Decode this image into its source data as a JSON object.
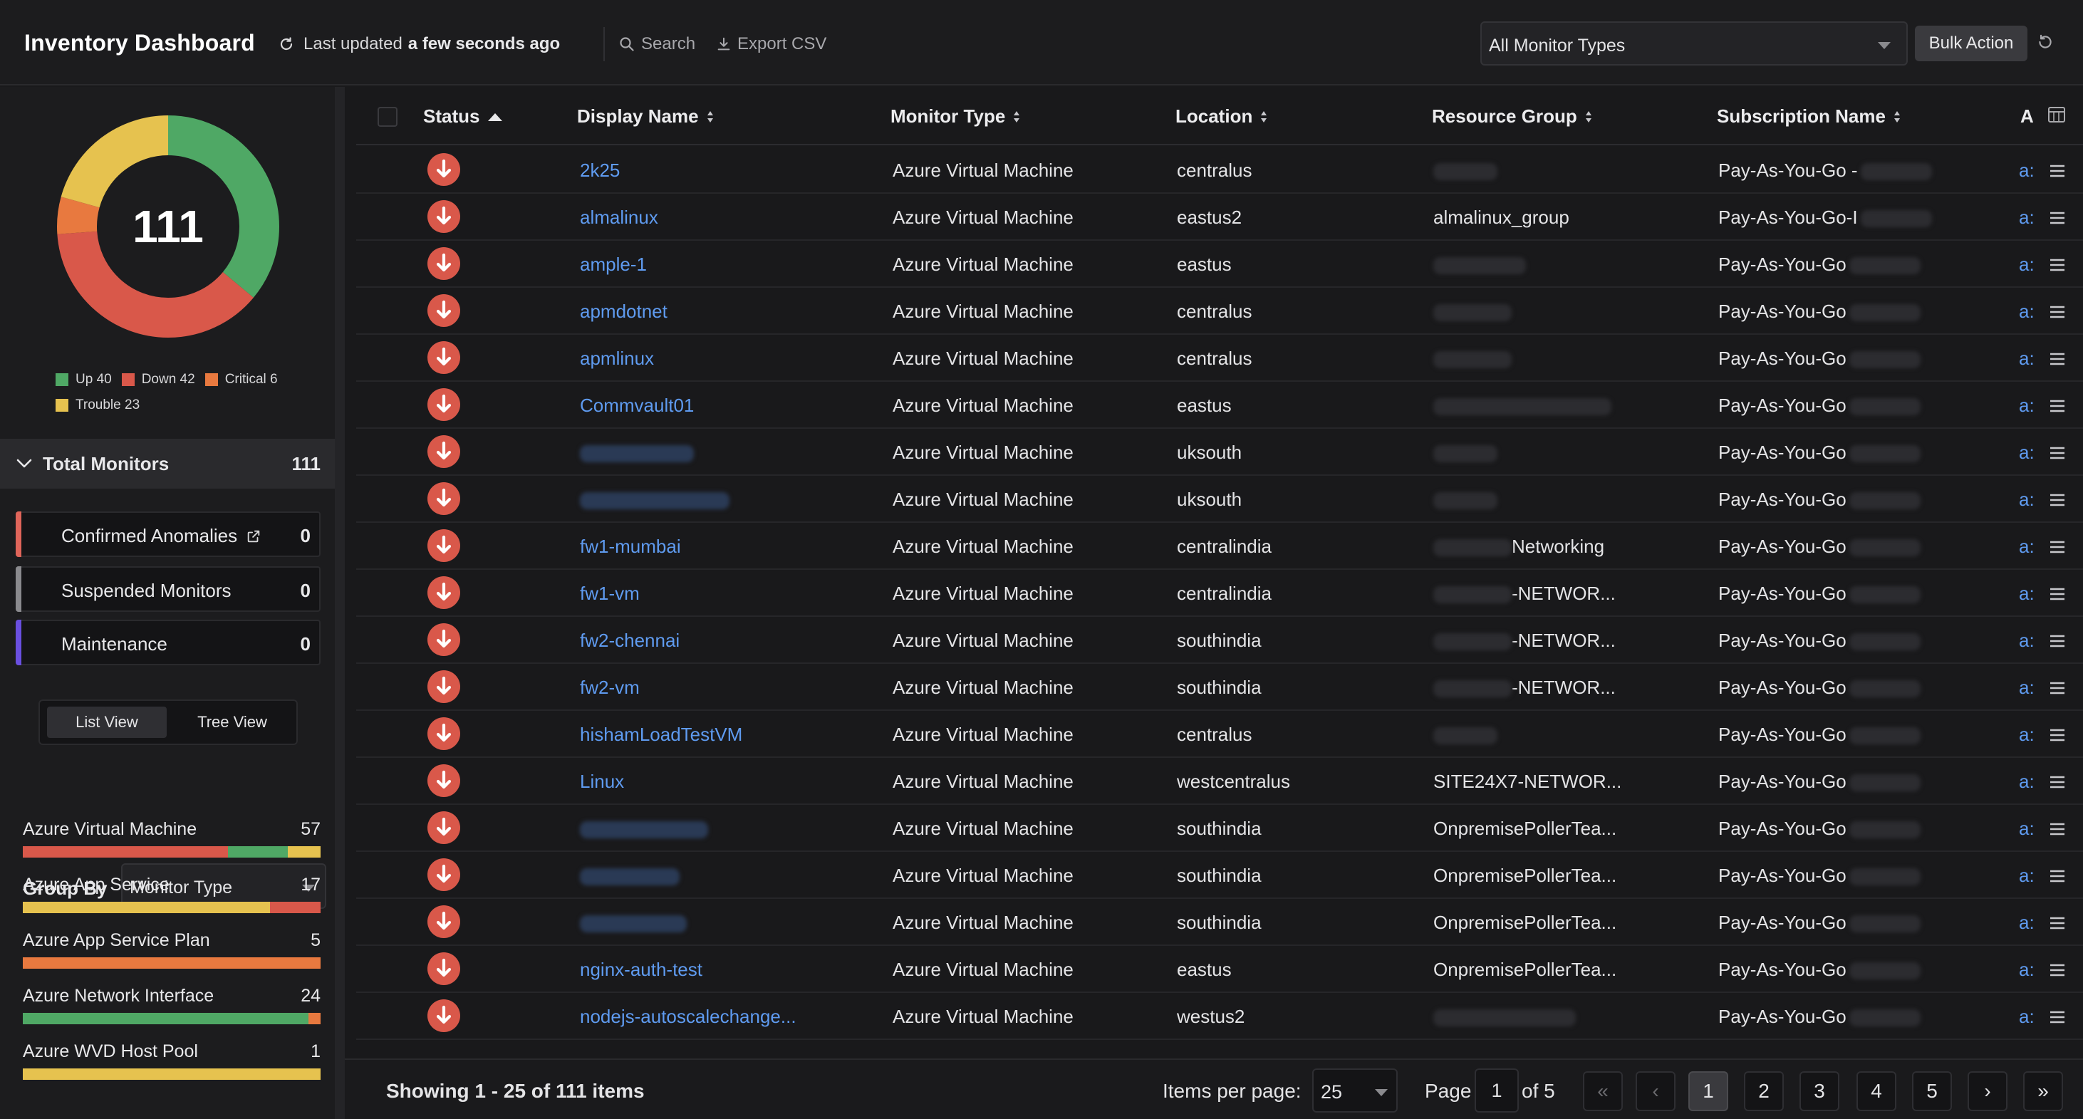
{
  "header": {
    "title": "Inventory Dashboard",
    "last_updated_label": "Last updated",
    "last_updated_value": "a few seconds ago",
    "search_label": "Search",
    "export_label": "Export CSV",
    "monitor_type_filter": "All Monitor Types",
    "bulk_action_label": "Bulk Action"
  },
  "summary": {
    "total": "111",
    "segments": [
      {
        "status": "Up",
        "count": 40,
        "color": "#4fa865"
      },
      {
        "status": "Down",
        "count": 42,
        "color": "#d9584a"
      },
      {
        "status": "Critical",
        "count": 6,
        "color": "#e8793f"
      },
      {
        "status": "Trouble",
        "count": 23,
        "color": "#e6c24f"
      }
    ],
    "legend": [
      {
        "label": "Up 40",
        "color": "#4fa865"
      },
      {
        "label": "Down 42",
        "color": "#d9584a"
      },
      {
        "label": "Critical 6",
        "color": "#e8793f"
      },
      {
        "label": "Trouble 23",
        "color": "#e6c24f"
      }
    ]
  },
  "sidebar": {
    "total_label": "Total Monitors",
    "total_count": "111",
    "cards": [
      {
        "label": "Confirmed Anomalies",
        "value": "0",
        "color": "#e0655a"
      },
      {
        "label": "Suspended Monitors",
        "value": "0",
        "color": "#8a8a8e"
      },
      {
        "label": "Maintenance",
        "value": "0",
        "color": "#6a4fe0"
      }
    ],
    "view_list": "List View",
    "view_tree": "Tree View",
    "group_by_label": "Group By",
    "group_by_value": "Monitor Type",
    "groups": [
      {
        "name": "Azure Virtual Machine",
        "count": "57",
        "parts": [
          {
            "fraction": 0.69,
            "color": "#d9584a"
          },
          {
            "fraction": 0.2,
            "color": "#4fa865"
          },
          {
            "fraction": 0.11,
            "color": "#e6c24f"
          }
        ]
      },
      {
        "name": "Azure App Service",
        "count": "17",
        "parts": [
          {
            "fraction": 0.83,
            "color": "#e6c24f"
          },
          {
            "fraction": 0.17,
            "color": "#d9584a"
          }
        ]
      },
      {
        "name": "Azure App Service Plan",
        "count": "5",
        "parts": [
          {
            "fraction": 1.0,
            "color": "#e8793f"
          }
        ]
      },
      {
        "name": "Azure Network Interface",
        "count": "24",
        "parts": [
          {
            "fraction": 0.96,
            "color": "#4fa865"
          },
          {
            "fraction": 0.04,
            "color": "#e8793f"
          }
        ]
      },
      {
        "name": "Azure WVD Host Pool",
        "count": "1",
        "parts": [
          {
            "fraction": 1.0,
            "color": "#e6c24f"
          }
        ]
      }
    ]
  },
  "table": {
    "columns": [
      "Status",
      "Display Name",
      "Monitor Type",
      "Location",
      "Resource Group",
      "Subscription Name",
      "A"
    ],
    "rows": [
      {
        "name": "2k25",
        "type": "Azure Virtual Machine",
        "location": "centralus",
        "rg": "",
        "sub": "Pay-As-You-Go -",
        "a": "a:"
      },
      {
        "name": "almalinux",
        "type": "Azure Virtual Machine",
        "location": "eastus2",
        "rg": "almalinux_group",
        "sub": "Pay-As-You-Go-I",
        "a": "a:"
      },
      {
        "name": "ample-1",
        "type": "Azure Virtual Machine",
        "location": "eastus",
        "rg": "",
        "sub": "Pay-As-You-Go",
        "a": "a:"
      },
      {
        "name": "apmdotnet",
        "type": "Azure Virtual Machine",
        "location": "centralus",
        "rg": "",
        "sub": "Pay-As-You-Go",
        "a": "a:"
      },
      {
        "name": "apmlinux",
        "type": "Azure Virtual Machine",
        "location": "centralus",
        "rg": "",
        "sub": "Pay-As-You-Go",
        "a": "a:"
      },
      {
        "name": "Commvault01",
        "type": "Azure Virtual Machine",
        "location": "eastus",
        "rg": "",
        "sub": "Pay-As-You-Go",
        "a": "a:"
      },
      {
        "name": "",
        "type": "Azure Virtual Machine",
        "location": "uksouth",
        "rg": "",
        "sub": "Pay-As-You-Go",
        "a": "a:"
      },
      {
        "name": "",
        "type": "Azure Virtual Machine",
        "location": "uksouth",
        "rg": "",
        "sub": "Pay-As-You-Go",
        "a": "a:"
      },
      {
        "name": "fw1-mumbai",
        "type": "Azure Virtual Machine",
        "location": "centralindia",
        "rg": "Networking",
        "sub": "Pay-As-You-Go",
        "a": "a:"
      },
      {
        "name": "fw1-vm",
        "type": "Azure Virtual Machine",
        "location": "centralindia",
        "rg": "-NETWOR...",
        "sub": "Pay-As-You-Go",
        "a": "a:"
      },
      {
        "name": "fw2-chennai",
        "type": "Azure Virtual Machine",
        "location": "southindia",
        "rg": "-NETWOR...",
        "sub": "Pay-As-You-Go",
        "a": "a:"
      },
      {
        "name": "fw2-vm",
        "type": "Azure Virtual Machine",
        "location": "southindia",
        "rg": "-NETWOR...",
        "sub": "Pay-As-You-Go",
        "a": "a:"
      },
      {
        "name": "hishamLoadTestVM",
        "type": "Azure Virtual Machine",
        "location": "centralus",
        "rg": "",
        "sub": "Pay-As-You-Go",
        "a": "a:"
      },
      {
        "name": "Linux",
        "type": "Azure Virtual Machine",
        "location": "westcentralus",
        "rg": "SITE24X7-NETWOR...",
        "sub": "Pay-As-You-Go",
        "a": "a:"
      },
      {
        "name": "",
        "type": "Azure Virtual Machine",
        "location": "southindia",
        "rg": "OnpremisePollerTea...",
        "sub": "Pay-As-You-Go",
        "a": "a:"
      },
      {
        "name": "",
        "type": "Azure Virtual Machine",
        "location": "southindia",
        "rg": "OnpremisePollerTea...",
        "sub": "Pay-As-You-Go",
        "a": "a:"
      },
      {
        "name": "",
        "type": "Azure Virtual Machine",
        "location": "southindia",
        "rg": "OnpremisePollerTea...",
        "sub": "Pay-As-You-Go",
        "a": "a:"
      },
      {
        "name": "nginx-auth-test",
        "type": "Azure Virtual Machine",
        "location": "eastus",
        "rg": "OnpremisePollerTea...",
        "sub": "Pay-As-You-Go",
        "a": "a:"
      },
      {
        "name": "nodejs-autoscalechange...",
        "type": "Azure Virtual Machine",
        "location": "westus2",
        "rg": "",
        "sub": "Pay-As-You-Go",
        "a": "a:"
      }
    ]
  },
  "footer": {
    "showing": "Showing 1 - 25 of 111 items",
    "items_per_page_label": "Items per page:",
    "items_per_page": "25",
    "page_label": "Page",
    "page_value": "1",
    "of_label": "of 5",
    "first": "«",
    "prev": "‹",
    "pages": [
      "1",
      "2",
      "3",
      "4",
      "5"
    ],
    "next": "›",
    "last": "»"
  }
}
